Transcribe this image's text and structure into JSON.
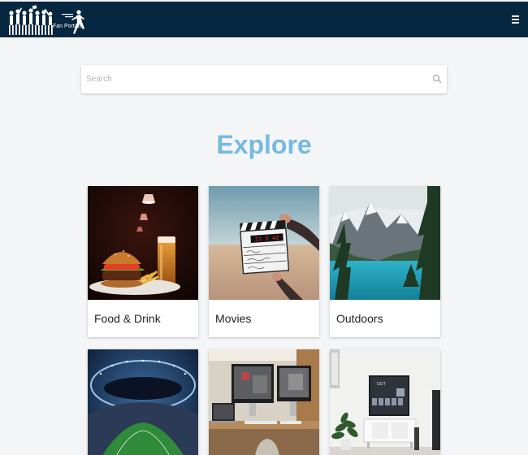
{
  "header": {
    "logo_text": "Fan Portals",
    "logo_icon": "crowd-logo",
    "menu_icon": "hamburger-icon",
    "background_color": "#072640"
  },
  "search": {
    "placeholder": "Search",
    "icon": "search-icon"
  },
  "main": {
    "title": "Explore",
    "title_color": "#76b9e0"
  },
  "categories": [
    {
      "label": "Food & Drink",
      "image": "burger-and-beer-photo"
    },
    {
      "label": "Movies",
      "image": "clapperboard-desert-photo"
    },
    {
      "label": "Outdoors",
      "image": "mountain-lake-photo"
    },
    {
      "label": "",
      "image": "stadium-photo"
    },
    {
      "label": "",
      "image": "desk-monitors-photo"
    },
    {
      "label": "",
      "image": "tv-living-room-photo"
    }
  ]
}
